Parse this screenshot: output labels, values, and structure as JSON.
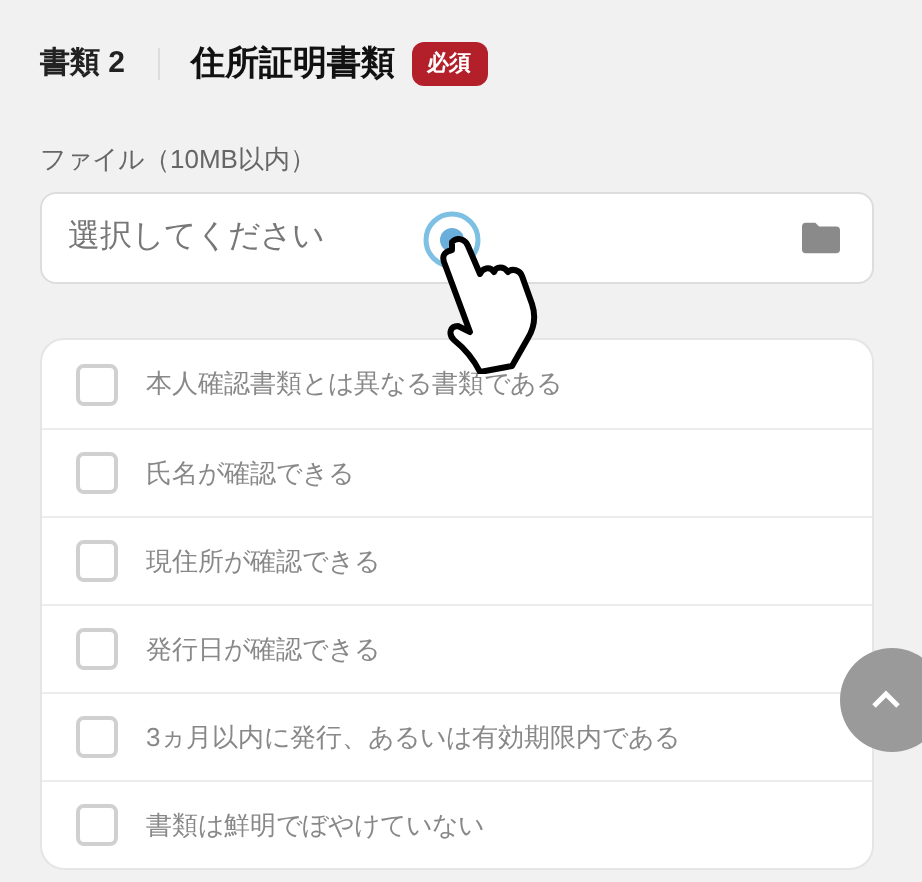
{
  "header": {
    "step": "書類 2",
    "title": "住所証明書類",
    "badge": "必須"
  },
  "file_field": {
    "label": "ファイル（10MB以内）",
    "placeholder": "選択してください"
  },
  "checklist": [
    {
      "label": "本人確認書類とは異なる書類である",
      "checked": false
    },
    {
      "label": "氏名が確認できる",
      "checked": false
    },
    {
      "label": "現住所が確認できる",
      "checked": false
    },
    {
      "label": "発行日が確認できる",
      "checked": false
    },
    {
      "label": "3ヵ月以内に発行、あるいは有効期限内である",
      "checked": false
    },
    {
      "label": "書類は鮮明でぼやけていない",
      "checked": false
    }
  ]
}
